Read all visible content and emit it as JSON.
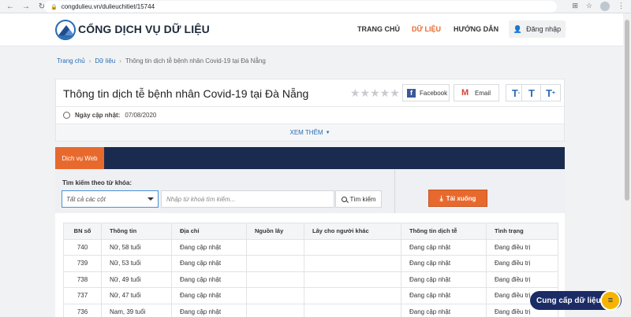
{
  "browser": {
    "url": "congdulieu.vn/dulieuchitiet/15744",
    "nav_icons": [
      "back-icon",
      "forward-icon",
      "reload-icon"
    ],
    "right_icons": [
      "translate-icon",
      "star-icon",
      "profile-icon",
      "menu-icon"
    ]
  },
  "header": {
    "brand": "CỔNG DỊCH VỤ DỮ LIỆU",
    "nav": [
      {
        "label": "TRANG CHỦ",
        "active": false
      },
      {
        "label": "DỮ LIỆU",
        "active": true
      },
      {
        "label": "HƯỚNG DẪN",
        "active": false
      }
    ],
    "login_label": "Đăng nhập"
  },
  "breadcrumb": {
    "home": "Trang chủ",
    "section": "Dữ liệu",
    "current": "Thông tin dịch tễ bệnh nhân Covid-19 tại Đà Nẵng"
  },
  "dataset": {
    "title": "Thông tin dịch tễ bệnh nhân Covid-19 tại Đà Nẵng",
    "rating_stars": 0,
    "rating_max": 5,
    "facebook_label": "Facebook",
    "email_label": "Email",
    "updated_label": "Ngày cập nhật:",
    "updated_value": "07/08/2020",
    "more_label": "XEM THÊM"
  },
  "tabs": {
    "active": "Dịch vụ Web"
  },
  "search": {
    "label": "Tìm kiếm theo từ khóa:",
    "column_select": "Tất cả các cột",
    "keyword_placeholder": "Nhập từ khoá tìm kiếm...",
    "search_button": "Tìm kiếm",
    "download_button": "Tải xuống"
  },
  "table": {
    "headers": [
      "BN số",
      "Thông tin",
      "Địa chỉ",
      "Nguồn lây",
      "Lây cho người khác",
      "Thông tin dịch tễ",
      "Tình trạng"
    ],
    "rows": [
      [
        "740",
        "Nữ, 58 tuổi",
        "Đang cập nhật",
        "",
        "",
        "Đang cập nhật",
        "Đang điều trị"
      ],
      [
        "739",
        "Nữ, 53 tuổi",
        "Đang cập nhật",
        "",
        "",
        "Đang cập nhật",
        "Đang điều trị"
      ],
      [
        "738",
        "Nữ, 49 tuổi",
        "Đang cập nhật",
        "",
        "",
        "Đang cập nhật",
        "Đang điều trị"
      ],
      [
        "737",
        "Nữ, 47 tuổi",
        "Đang cập nhật",
        "",
        "",
        "Đang cập nhật",
        "Đang điều trị"
      ],
      [
        "736",
        "Nam, 39 tuổi",
        "Đang cập nhật",
        "",
        "",
        "Đang cập nhật",
        "Đang điều trị"
      ]
    ]
  },
  "floating": {
    "label": "Cung cấp dữ liệu"
  },
  "colors": {
    "accent": "#e8692d",
    "navy": "#1b2b4f",
    "link": "#2a6bb3"
  }
}
